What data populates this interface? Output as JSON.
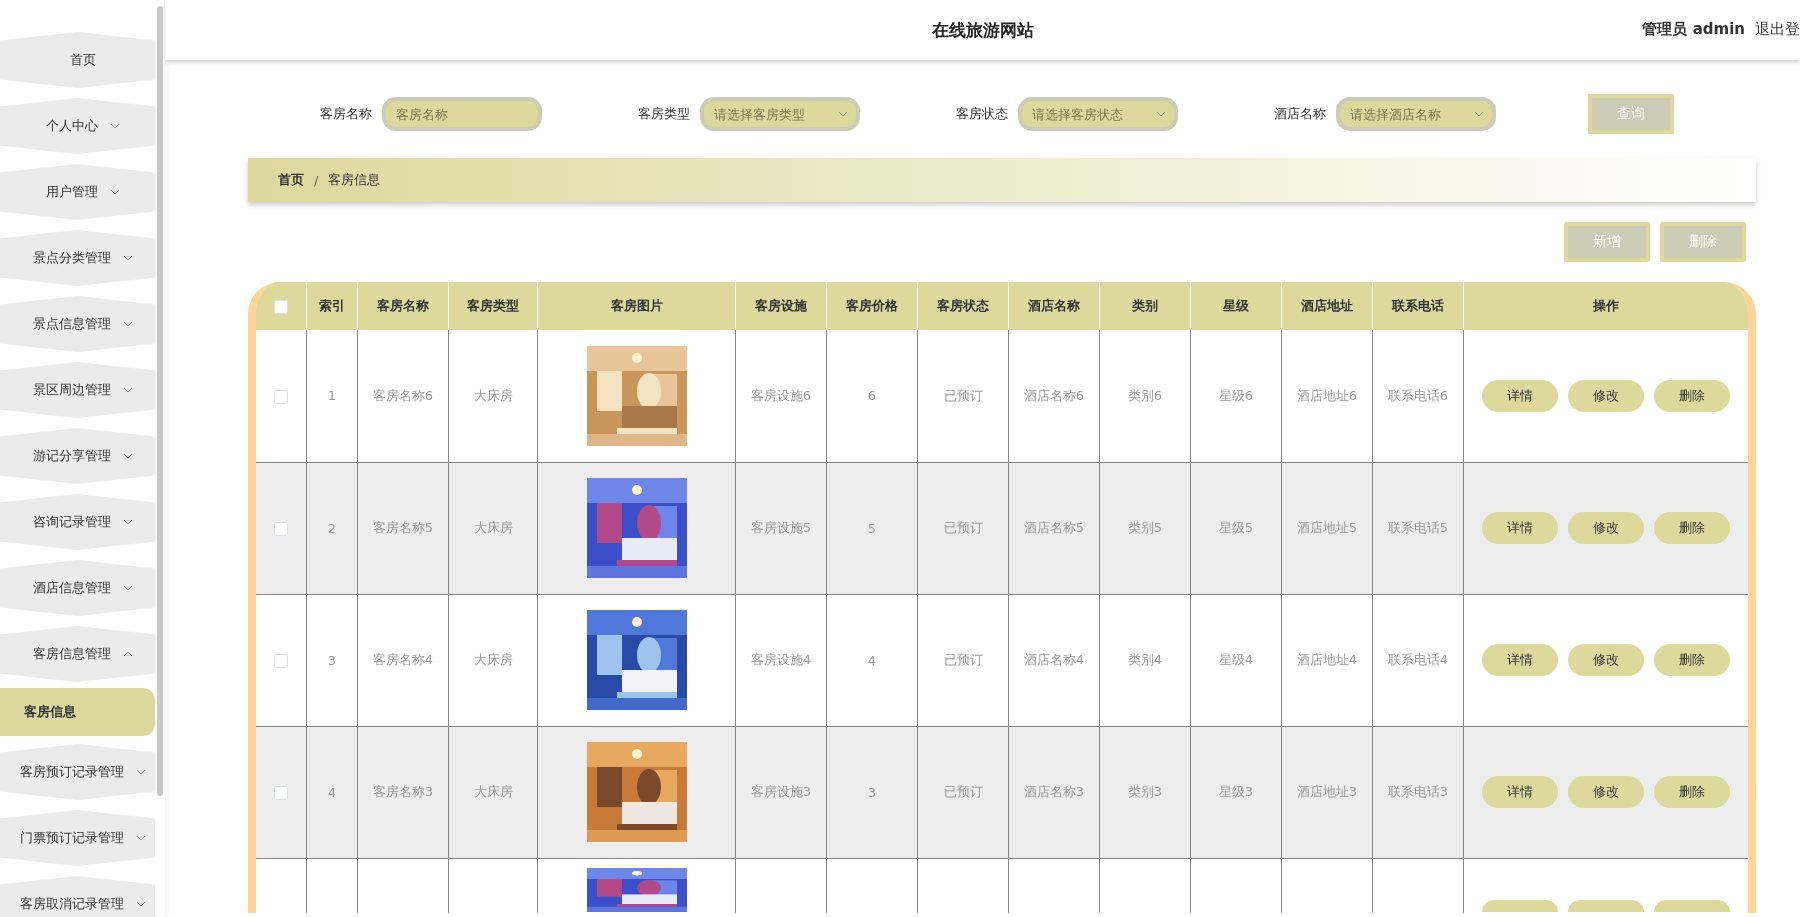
{
  "header": {
    "title": "在线旅游网站",
    "user_label": "管理员 admin",
    "logout": "退出登"
  },
  "sidebar": {
    "items": [
      {
        "label": "首页",
        "kind": "link"
      },
      {
        "label": "个人中心",
        "kind": "menu",
        "expanded": false
      },
      {
        "label": "用户管理",
        "kind": "menu",
        "expanded": false
      },
      {
        "label": "景点分类管理",
        "kind": "menu",
        "expanded": false
      },
      {
        "label": "景点信息管理",
        "kind": "menu",
        "expanded": false
      },
      {
        "label": "景区周边管理",
        "kind": "menu",
        "expanded": false
      },
      {
        "label": "游记分享管理",
        "kind": "menu",
        "expanded": false
      },
      {
        "label": "咨询记录管理",
        "kind": "menu",
        "expanded": false
      },
      {
        "label": "酒店信息管理",
        "kind": "menu",
        "expanded": false
      },
      {
        "label": "客房信息管理",
        "kind": "menu",
        "expanded": true,
        "children": [
          {
            "label": "客房信息",
            "selected": true
          }
        ]
      },
      {
        "label": "客房预订记录管理",
        "kind": "menu",
        "expanded": false
      },
      {
        "label": "门票预订记录管理",
        "kind": "menu",
        "expanded": false
      },
      {
        "label": "客房取消记录管理",
        "kind": "menu",
        "expanded": false
      }
    ]
  },
  "search": {
    "fields": [
      {
        "label": "客房名称",
        "kind": "text",
        "placeholder": "客房名称"
      },
      {
        "label": "客房类型",
        "kind": "select",
        "placeholder": "请选择客房类型"
      },
      {
        "label": "客房状态",
        "kind": "select",
        "placeholder": "请选择客房状态"
      },
      {
        "label": "酒店名称",
        "kind": "select",
        "placeholder": "请选择酒店名称"
      }
    ],
    "button": "查询"
  },
  "breadcrumb": {
    "items": [
      "首页",
      "客房信息"
    ],
    "separator": "/"
  },
  "toolbar": [
    "新增",
    "删除"
  ],
  "table": {
    "select_all": false,
    "columns": [
      "索引",
      "客房名称",
      "客房类型",
      "客房图片",
      "客房设施",
      "客房价格",
      "客房状态",
      "酒店名称",
      "类别",
      "星级",
      "酒店地址",
      "联系电话",
      "操作"
    ],
    "rows": [
      {
        "kind": "full",
        "checked": false,
        "cells": [
          "1",
          "客房名称6",
          "大床房",
          "客房设施6",
          "6",
          "已预订",
          "酒店名称6",
          "类别6",
          "星级6",
          "酒店地址6",
          "联系电话6"
        ],
        "actions": [
          "详情",
          "修改",
          "删除"
        ]
      },
      {
        "kind": "full",
        "checked": false,
        "cells": [
          "2",
          "客房名称5",
          "大床房",
          "客房设施5",
          "5",
          "已预订",
          "酒店名称5",
          "类别5",
          "星级5",
          "酒店地址5",
          "联系电话5"
        ],
        "actions": [
          "详情",
          "修改",
          "删除"
        ]
      },
      {
        "kind": "full",
        "checked": false,
        "cells": [
          "3",
          "客房名称4",
          "大床房",
          "客房设施4",
          "4",
          "已预订",
          "酒店名称4",
          "类别4",
          "星级4",
          "酒店地址4",
          "联系电话4"
        ],
        "actions": [
          "详情",
          "修改",
          "删除"
        ]
      },
      {
        "kind": "full",
        "checked": false,
        "cells": [
          "4",
          "客房名称3",
          "大床房",
          "客房设施3",
          "3",
          "已预订",
          "酒店名称3",
          "类别3",
          "星级3",
          "酒店地址3",
          "联系电话3"
        ],
        "actions": [
          "详情",
          "修改",
          "删除"
        ]
      },
      {
        "kind": "cut"
      }
    ]
  }
}
